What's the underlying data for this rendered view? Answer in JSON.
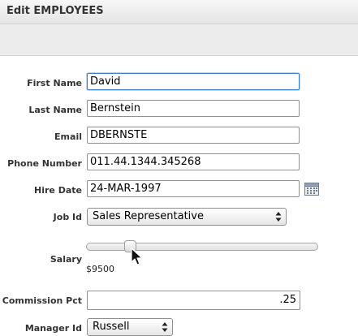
{
  "window": {
    "title": "Edit EMPLOYEES"
  },
  "form": {
    "first_name": {
      "label": "First Name",
      "value": "David"
    },
    "last_name": {
      "label": "Last Name",
      "value": "Bernstein"
    },
    "email": {
      "label": "Email",
      "value": "DBERNSTE"
    },
    "phone_number": {
      "label": "Phone Number",
      "value": "011.44.1344.345268"
    },
    "hire_date": {
      "label": "Hire Date",
      "value": "24-MAR-1997"
    },
    "job_id": {
      "label": "Job Id",
      "value": "Sales Representative"
    },
    "salary": {
      "label": "Salary",
      "value": "$9500"
    },
    "commission_pct": {
      "label": "Commission Pct",
      "value": ".25"
    },
    "manager_id": {
      "label": "Manager Id",
      "value": "Russell"
    }
  },
  "icons": {
    "calendar": "calendar-icon",
    "select_arrows": "up-down-arrows-icon",
    "cursor": "mouse-pointer-icon"
  }
}
